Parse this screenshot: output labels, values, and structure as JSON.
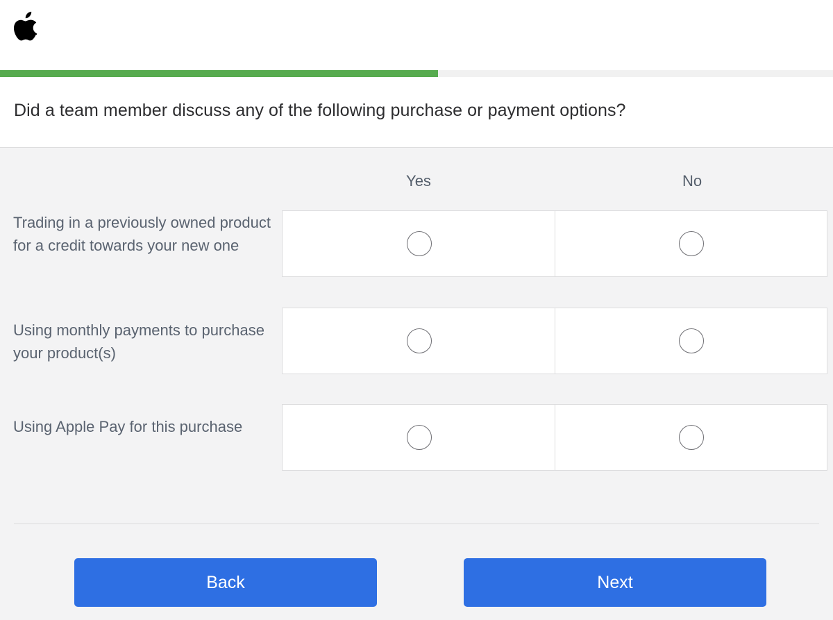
{
  "header": {
    "logo_icon": "apple-logo-icon"
  },
  "progress": {
    "fraction": 0.526,
    "color": "#57ab4f"
  },
  "question": {
    "text": "Did a team member discuss any of the following purchase or payment options?"
  },
  "matrix": {
    "columns": [
      "Yes",
      "No"
    ],
    "rows": [
      {
        "label": "Trading in a previously owned product for a credit towards your new one"
      },
      {
        "label": "Using monthly payments to purchase your product(s)"
      },
      {
        "label": "Using Apple Pay for this purchase"
      }
    ]
  },
  "buttons": {
    "back_label": "Back",
    "next_label": "Next",
    "color": "#2e6fe3"
  }
}
